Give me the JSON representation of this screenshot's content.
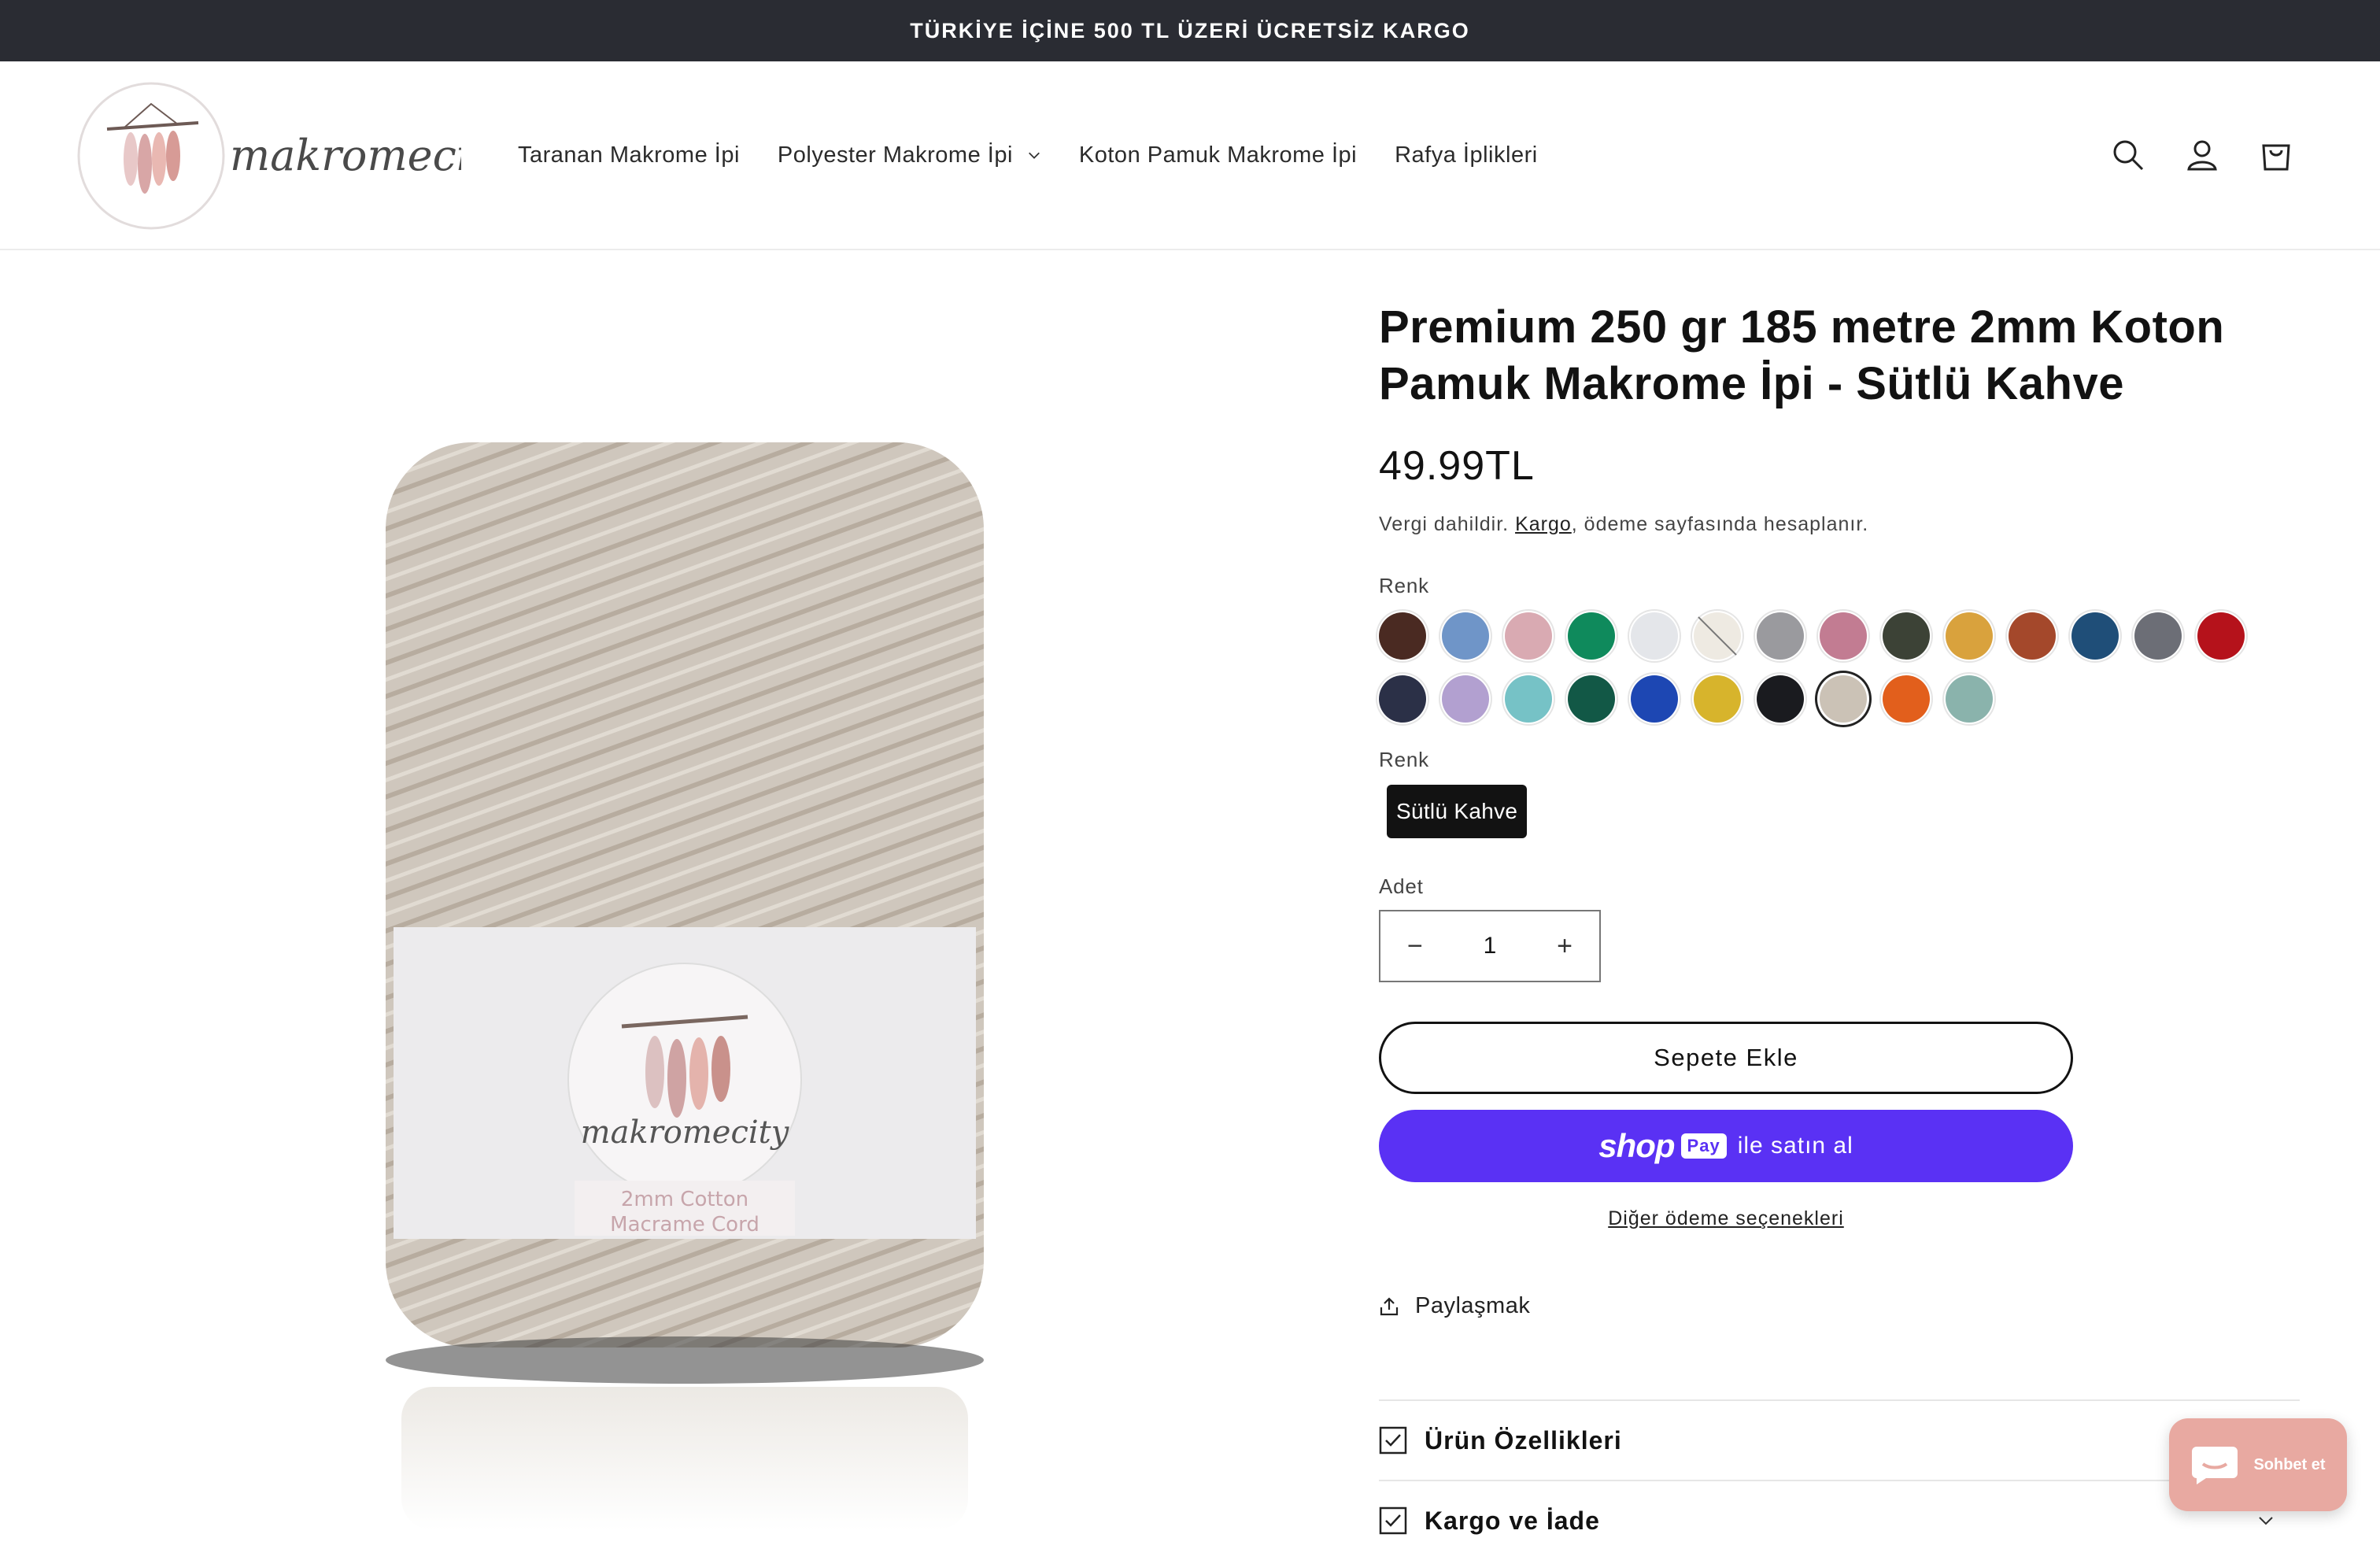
{
  "announcement": "TÜRKİYE İÇİNE 500 TL ÜZERİ ÜCRETSİZ KARGO",
  "logo_text": "makromecity",
  "nav": [
    {
      "label": "Taranan Makrome İpi"
    },
    {
      "label": "Polyester Makrome İpi"
    },
    {
      "label": "Koton Pamuk Makrome İpi"
    },
    {
      "label": "Rafya İplikleri"
    }
  ],
  "header_icons": [
    "search-icon",
    "account-icon",
    "cart-icon"
  ],
  "product": {
    "title": "Premium 250 gr 185 metre 2mm Koton Pamuk Makrome İpi - Sütlü Kahve",
    "price": "49.99TL",
    "tax_prefix": "Vergi dahildir.",
    "tax_link": "Kargo",
    "tax_suffix": ", ödeme sayfasında hesaplanır.",
    "label_text_1": "2mm Cotton",
    "label_text_2": "Macrame Cord"
  },
  "swatch_label": "Renk",
  "swatches": [
    {
      "color": "#4a2a22"
    },
    {
      "color": "#6f95c8"
    },
    {
      "color": "#d9aab2"
    },
    {
      "color": "#0f8a5c"
    },
    {
      "color": "#e4e6ea"
    },
    {
      "color": "#eeeae2",
      "disabled": true
    },
    {
      "color": "#9a9a9e"
    },
    {
      "color": "#c27c92"
    },
    {
      "color": "#3c4236"
    },
    {
      "color": "#d9a23d"
    },
    {
      "color": "#a4482b"
    },
    {
      "color": "#1f4e78"
    },
    {
      "color": "#6c6e76"
    },
    {
      "color": "#b5121b"
    },
    {
      "color": "#2b3047"
    },
    {
      "color": "#b2a0d0"
    },
    {
      "color": "#76c2c6"
    },
    {
      "color": "#125846"
    },
    {
      "color": "#1d47b3"
    },
    {
      "color": "#d7b42c"
    },
    {
      "color": "#1a1b1f"
    },
    {
      "color": "#cbc2b6",
      "selected": true
    },
    {
      "color": "#e25f1c"
    },
    {
      "color": "#8ab3ac"
    }
  ],
  "variant_label": "Renk",
  "variant_value": "Sütlü Kahve",
  "qty_label": "Adet",
  "qty_value": "1",
  "qty_minus": "−",
  "qty_plus": "+",
  "add_to_cart": "Sepete Ekle",
  "shoppay": {
    "brand": "shop",
    "badge": "Pay",
    "text": "ile satın al"
  },
  "more_payment": "Diğer ödeme seçenekleri",
  "share": "Paylaşmak",
  "accordions": [
    {
      "title": "Ürün Özellikleri"
    },
    {
      "title": "Kargo ve İade"
    }
  ],
  "chat": "Sohbet et",
  "colors": {
    "announcement_bg": "#2a2c33",
    "shoppay": "#5a31f4",
    "chat_bg": "#e8a9a1"
  }
}
